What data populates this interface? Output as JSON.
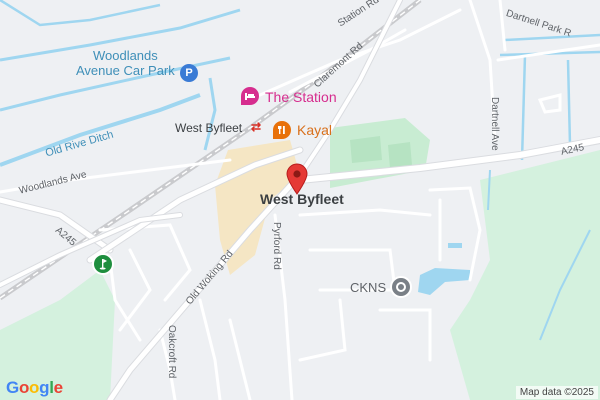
{
  "map": {
    "place_label": "West Byfleet",
    "pois": {
      "hotel": "The Station",
      "restaurant": "Kayal",
      "gym": "CKNS",
      "car_park_line1": "Woodlands",
      "car_park_line2": "Avenue Car Park",
      "rail_station": "West Byfleet"
    },
    "streets": {
      "station_rd": "Station Rd",
      "claremont_rd": "Claremont Rd",
      "dartnell_park_rd": "Dartnell Park R",
      "dartnell_ave": "Dartnell Ave",
      "woodlands_ave": "Woodlands Ave",
      "a245_left": "A245",
      "a245_right": "A245",
      "pyrford_rd": "Pyrford Rd",
      "old_woking_rd": "Old Woking Rd",
      "oakcroft_rd": "Oakcroft Rd"
    },
    "water": {
      "old_rive_ditch": "Old Rive Ditch"
    },
    "colors": {
      "land": "#eef0f3",
      "road": "#ffffff",
      "major_road": "#dadce0",
      "water": "#9fd6f0",
      "park": "#c8ecd2",
      "town_centre": "#f5e6c4",
      "rail": "#c9cacd",
      "pin": "#e53935",
      "hotel_icon": "#d62d8e",
      "food_icon": "#e8710a",
      "gym_icon": "#7a8087",
      "parking_icon": "#3a7bd5",
      "golf_icon": "#1e8e3e"
    },
    "icons": {
      "pin": "location-pin-icon",
      "hotel": "bed-icon",
      "restaurant": "fork-knife-icon",
      "gym": "dumbbell-icon",
      "parking": "parking-icon",
      "golf": "golf-icon",
      "rail": "rail-icon"
    }
  },
  "footer": {
    "brand": "Google",
    "attribution": "Map data ©2025"
  }
}
